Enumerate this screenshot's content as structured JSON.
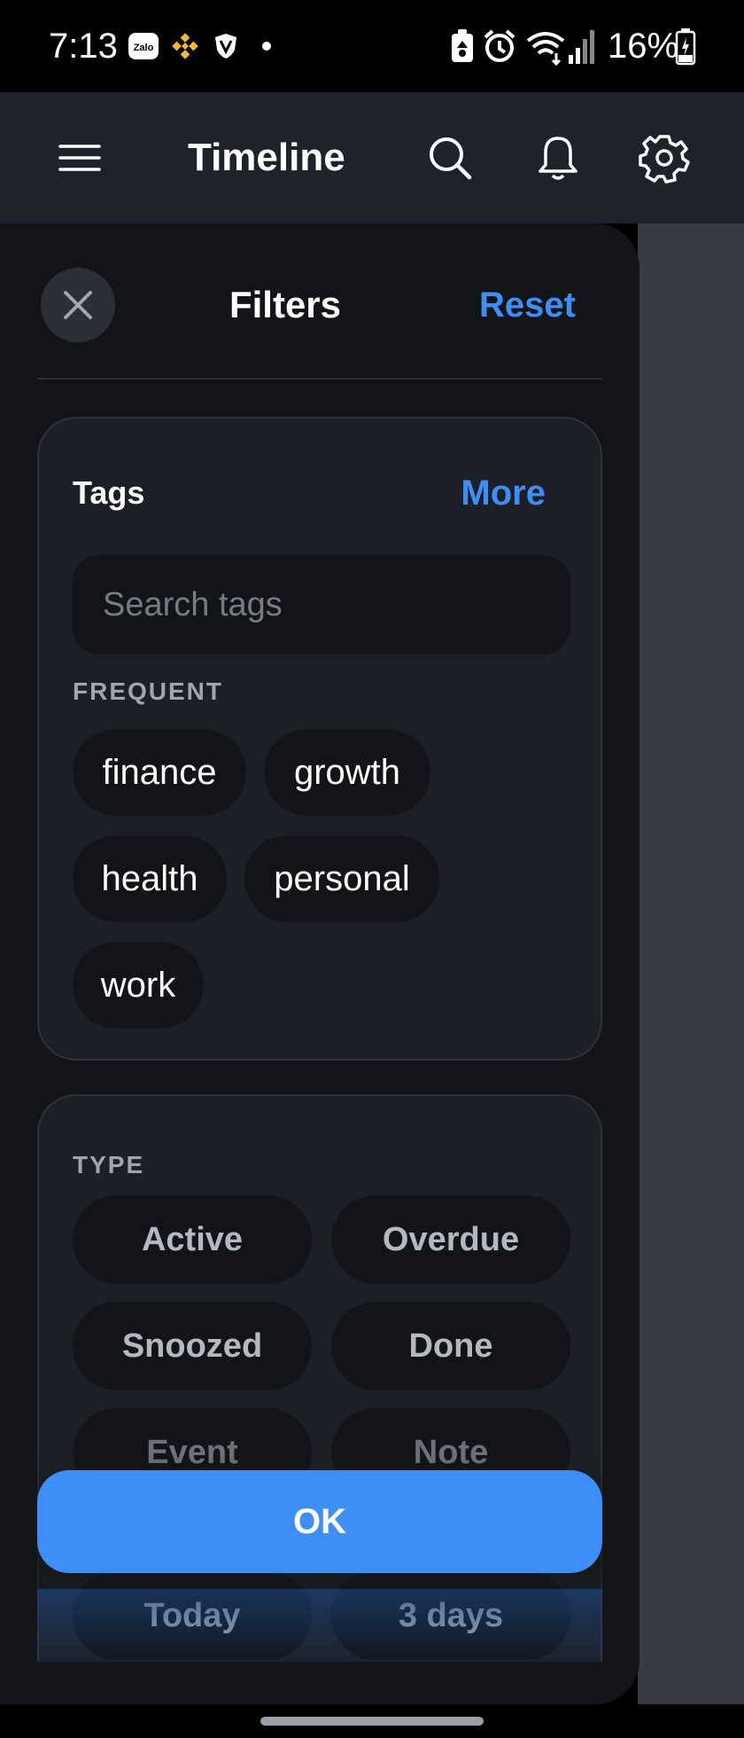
{
  "status_bar": {
    "time": "7:13",
    "battery": "16%",
    "icons": [
      "zalo-icon",
      "binance-icon",
      "shield-icon",
      "dot-icon",
      "battery-saver-icon",
      "alarm-icon",
      "wifi-icon",
      "signal-icon",
      "battery-icon"
    ],
    "zalo_label": "Zalo"
  },
  "app_bar": {
    "title": "Timeline",
    "icons": [
      "menu-icon",
      "search-icon",
      "bell-icon",
      "gear-icon"
    ]
  },
  "drawer": {
    "title": "Filters",
    "reset_label": "Reset",
    "tags": {
      "heading": "Tags",
      "more_label": "More",
      "search_placeholder": "Search tags",
      "frequent_label": "FREQUENT",
      "items": [
        "finance",
        "growth",
        "health",
        "personal",
        "work"
      ]
    },
    "type": {
      "heading": "TYPE",
      "items": [
        "Active",
        "Overdue",
        "Snoozed",
        "Done",
        "Event",
        "Note"
      ]
    },
    "range": {
      "items": [
        "Today",
        "3 days"
      ]
    },
    "ok_label": "OK"
  },
  "colors": {
    "accent": "#3d8ef5",
    "drawer_bg": "#121418",
    "card_bg": "#1c1f26",
    "app_bar_bg": "#1e222a"
  }
}
